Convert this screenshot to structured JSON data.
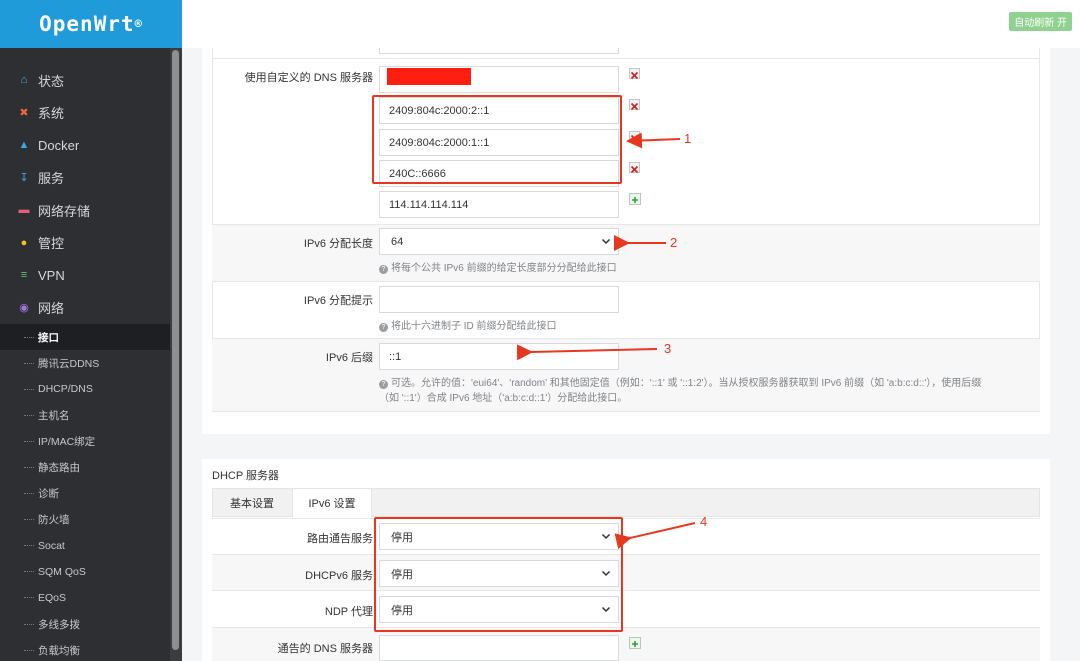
{
  "brand": {
    "name": "OpenWrt",
    "mark": "®"
  },
  "topbar": {
    "auto_refresh": "自动刷新 开"
  },
  "sidebar": {
    "items": [
      {
        "label": "状态",
        "icon": "home-icon"
      },
      {
        "label": "系统",
        "icon": "tools-icon"
      },
      {
        "label": "Docker",
        "icon": "docker-icon"
      },
      {
        "label": "服务",
        "icon": "download-icon"
      },
      {
        "label": "网络存储",
        "icon": "storage-icon"
      },
      {
        "label": "管控",
        "icon": "shield-icon"
      },
      {
        "label": "VPN",
        "icon": "vpn-icon"
      },
      {
        "label": "网络",
        "icon": "globe-icon"
      }
    ],
    "subitems": [
      "接口",
      "腾讯云DDNS",
      "DHCP/DNS",
      "主机名",
      "IP/MAC绑定",
      "静态路由",
      "诊断",
      "防火墙",
      "Socat",
      "SQM QoS",
      "EQoS",
      "多线多拨",
      "负载均衡"
    ],
    "active_subitem": "接口"
  },
  "dns": {
    "label": "使用自定义的 DNS 服务器",
    "servers": [
      "2409:804c:2000:2::1",
      "2409:804c:2000:1::1",
      "240C::6666",
      "114.114.114.114"
    ]
  },
  "ipv6_assign_length": {
    "label": "IPv6 分配长度",
    "value": "64",
    "hint": "将每个公共 IPv6 前缀的给定长度部分分配给此接口"
  },
  "ipv6_assign_hint": {
    "label": "IPv6 分配提示",
    "value": "",
    "hint": "将此十六进制子 ID 前缀分配给此接口"
  },
  "ipv6_suffix": {
    "label": "IPv6 后缀",
    "value": "::1",
    "hint_line1": "可选。允许的值：'eui64'、'random' 和其他固定值（例如：'::1' 或 '::1:2'）。当从授权服务器获取到 IPv6 前缀（如 'a:b:c:d::'），使用后缀",
    "hint_line2": "（如 '::1'）合成 IPv6 地址（'a:b:c:d::1'）分配给此接口。"
  },
  "dhcp": {
    "title": "DHCP 服务器",
    "tabs": [
      "基本设置",
      "IPv6 设置"
    ],
    "active_tab": "IPv6 设置",
    "router_advert": {
      "label": "路由通告服务",
      "value": "停用"
    },
    "dhcpv6": {
      "label": "DHCPv6 服务",
      "value": "停用"
    },
    "ndp": {
      "label": "NDP 代理",
      "value": "停用"
    },
    "announced_dns": {
      "label": "通告的 DNS 服务器",
      "value": ""
    }
  },
  "annotations": [
    "1",
    "2",
    "3",
    "4"
  ],
  "colors": {
    "brand": "#1e9bd8",
    "sidebar": "#2d2f33",
    "annotation": "#e8371f",
    "auto_refresh": "#8fd18f"
  }
}
